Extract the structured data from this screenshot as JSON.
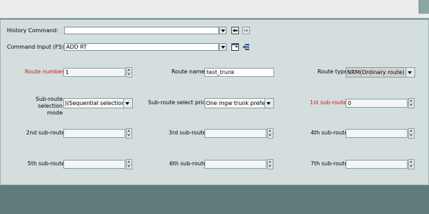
{
  "history": {
    "label": "History Command:",
    "value": ""
  },
  "command_input": {
    "label": "Command Input (F5):",
    "value": "ADD RT"
  },
  "icons": [
    "back-arrow-icon",
    "forward-arrow-icon",
    "open-window-icon",
    "insert-icon"
  ],
  "colors": {
    "required_label": "#d01818",
    "panel": "#d4dede",
    "background": "#5f7b7b"
  },
  "form": {
    "route_number": {
      "label": "Route number",
      "value": "1"
    },
    "route_name": {
      "label": "Route name",
      "value": "test_trunk"
    },
    "route_type": {
      "label": "Route type",
      "value": "NRM(Ordinary route)"
    },
    "subroute_selection_mode": {
      "label_line1": "Sub-route selection",
      "label_line2": "mode",
      "value": ")(Sequential selection)"
    },
    "subroute_select_prior": {
      "label": "Sub-route select prior",
      "value": "One mgw trunk prefer"
    },
    "sub1": {
      "label": "1st sub-route",
      "value": "0"
    },
    "sub2": {
      "label": "2nd sub-route",
      "value": ""
    },
    "sub3": {
      "label": "3rd sub-route",
      "value": ""
    },
    "sub4": {
      "label": "4th sub-route",
      "value": ""
    },
    "sub5": {
      "label": "5th sub-route",
      "value": ""
    },
    "sub6": {
      "label": "6th sub-route",
      "value": ""
    },
    "sub7": {
      "label": "7th sub-route",
      "value": ""
    }
  }
}
